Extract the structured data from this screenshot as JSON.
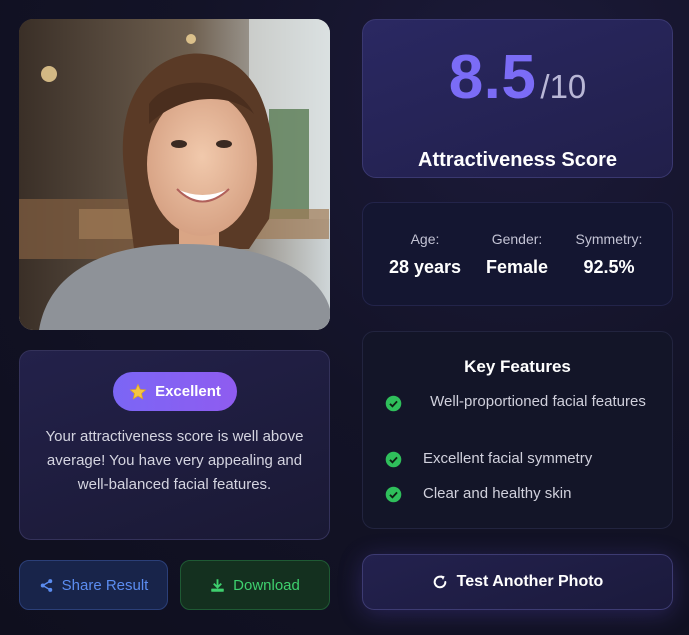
{
  "photo": {
    "icon": "portrait-photo"
  },
  "result": {
    "badge_label": "Excellent",
    "badge_icon": "star-icon",
    "description": "Your attractiveness score is well above average! You have very appealing and well-balanced facial features."
  },
  "actions": {
    "share_label": "Share Result",
    "download_label": "Download",
    "test_label": "Test Another Photo"
  },
  "score": {
    "value": "8.5",
    "max": "/10",
    "label": "Attractiveness Score"
  },
  "stats": [
    {
      "label": "Age:",
      "value": "28 years"
    },
    {
      "label": "Gender:",
      "value": "Female"
    },
    {
      "label": "Symmetry:",
      "value": "92.5%"
    }
  ],
  "features": {
    "title": "Key Features",
    "items": [
      {
        "text": "Well-proportioned facial features"
      },
      {
        "text": "Excellent facial symmetry"
      },
      {
        "text": "Clear and healthy skin"
      }
    ]
  },
  "colors": {
    "accent": "#7b6cf6",
    "badge": "#8f5cf0",
    "share": "#5b8cf0",
    "download": "#3ed06e",
    "check": "#2fbf5b"
  }
}
